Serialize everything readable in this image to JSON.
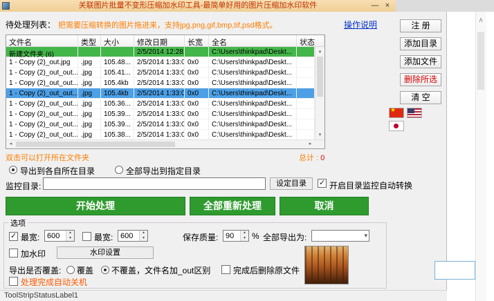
{
  "window": {
    "title": "关联图片批量不变形压缩加水印工具-最简单好用的图片压缩加水印软件",
    "minimize_glyph": "—",
    "close_glyph": "×"
  },
  "header": {
    "list_label": "待处理列表：",
    "hint": "把需要压缩转换的图片拖进来，支持jpg,png,gif,bmp,tif,psd格式。",
    "help_link": "操作说明"
  },
  "side_buttons": {
    "register": "注 册",
    "add_directory": "添加目录",
    "add_files": "添加文件",
    "delete_selected": "删除所选",
    "clear": "清 空"
  },
  "flags": [
    "China",
    "USA",
    "Japan"
  ],
  "table": {
    "columns": [
      "文件名",
      "类型",
      "大小",
      "修改日期",
      "长宽",
      "全名",
      "状态"
    ],
    "rows": [
      {
        "name": "新建文件夹 (6)",
        "type": "",
        "size": "",
        "date": "2/5/2014 12:28:...",
        "dims": "",
        "path": "C:\\Users\\thinkpad\\Deskt...",
        "state": "",
        "highlight": "green"
      },
      {
        "name": "1 - Copy (2)_out.jpg",
        "type": ".jpg",
        "size": "105.48...",
        "date": "2/5/2014 1:33:0...",
        "dims": "0x0",
        "path": "C:\\Users\\thinkpad\\Deskt...",
        "state": "",
        "highlight": ""
      },
      {
        "name": "1 - Copy (2)_out_out...",
        "type": ".jpg",
        "size": "105.41...",
        "date": "2/5/2014 1:33:0...",
        "dims": "0x0",
        "path": "C:\\Users\\thinkpad\\Deskt...",
        "state": "",
        "highlight": ""
      },
      {
        "name": "1 - Copy (2)_out_out...",
        "type": ".jpg",
        "size": "105.4kb",
        "date": "2/5/2014 1:33:0...",
        "dims": "0x0",
        "path": "C:\\Users\\thinkpad\\Deskt...",
        "state": "",
        "highlight": ""
      },
      {
        "name": "1 - Copy (2)_out_out...",
        "type": ".jpg",
        "size": "105.4kb",
        "date": "2/5/2014 1:33:0...",
        "dims": "0x0",
        "path": "C:\\Users\\thinkpad\\Deskt...",
        "state": "",
        "highlight": "selected"
      },
      {
        "name": "1 - Copy (2)_out_out...",
        "type": ".jpg",
        "size": "105.36...",
        "date": "2/5/2014 1:33:0...",
        "dims": "0x0",
        "path": "C:\\Users\\thinkpad\\Deskt...",
        "state": "",
        "highlight": ""
      },
      {
        "name": "1 - Copy (2)_out_out...",
        "type": ".jpg",
        "size": "105.39...",
        "date": "2/5/2014 1:33:0...",
        "dims": "0x0",
        "path": "C:\\Users\\thinkpad\\Deskt...",
        "state": "",
        "highlight": ""
      },
      {
        "name": "1 - Copy (2)_out_out...",
        "type": ".jpg",
        "size": "105.39...",
        "date": "2/5/2014 1:33:0...",
        "dims": "0x0",
        "path": "C:\\Users\\thinkpad\\Deskt...",
        "state": "",
        "highlight": ""
      },
      {
        "name": "1 - Copy (2)_out_out...",
        "type": ".jpg",
        "size": "105.38...",
        "date": "2/5/2014 1:33:0...",
        "dims": "0x0",
        "path": "C:\\Users\\thinkpad\\Deskt...",
        "state": "",
        "highlight": ""
      }
    ]
  },
  "table_footer": {
    "tip": "双击可以打开所在文件夹",
    "total_label": "总计 :",
    "total_value": "0"
  },
  "export_target": {
    "own_dir": "导出到各自所在目录",
    "own_dir_selected": true,
    "specified_dir": "全部导出到指定目录",
    "specified_dir_selected": false
  },
  "monitor": {
    "label": "监控目录:",
    "input_value": "",
    "set_button": "设定目录",
    "auto_checkbox": "开启目录监控自动转换",
    "auto_checked": true
  },
  "actions": {
    "start": "开始处理",
    "reprocess_all": "全部重新处理",
    "cancel": "取消"
  },
  "options": {
    "group_label": "选项",
    "max_width_label": "最宽:",
    "max_width_value": "600",
    "max_width_checked": true,
    "max_width2_label": "最宽:",
    "max_width2_value": "600",
    "max_width2_checked": false,
    "quality_label": "保存质量:",
    "quality_value": "90",
    "quality_unit": "%",
    "export_as_label": "全部导出为:",
    "export_as_value": "",
    "watermark_checkbox": "加水印",
    "watermark_checked": false,
    "watermark_settings_button": "水印设置",
    "overwrite_label": "导出是否覆盖:",
    "overwrite_radio": "覆盖",
    "overwrite_selected": false,
    "no_overwrite_radio": "不覆盖，文件名加_out区别",
    "no_overwrite_selected": true,
    "delete_original_checkbox": "完成后删除原文件",
    "delete_original_checked": false,
    "shutdown_checkbox": "处理完成自动关机",
    "shutdown_checked": false
  },
  "statusbar": {
    "text": "ToolStripStatusLabel1"
  },
  "colors": {
    "titlebar": "#f3d6a4",
    "title_text": "#c03000",
    "accent_green": "#2f9b2f",
    "row_green": "#43b649",
    "row_selected": "#4da0e6",
    "orange_text": "#ff7d00",
    "red_text": "#e60000",
    "link_blue": "#0633cc"
  }
}
